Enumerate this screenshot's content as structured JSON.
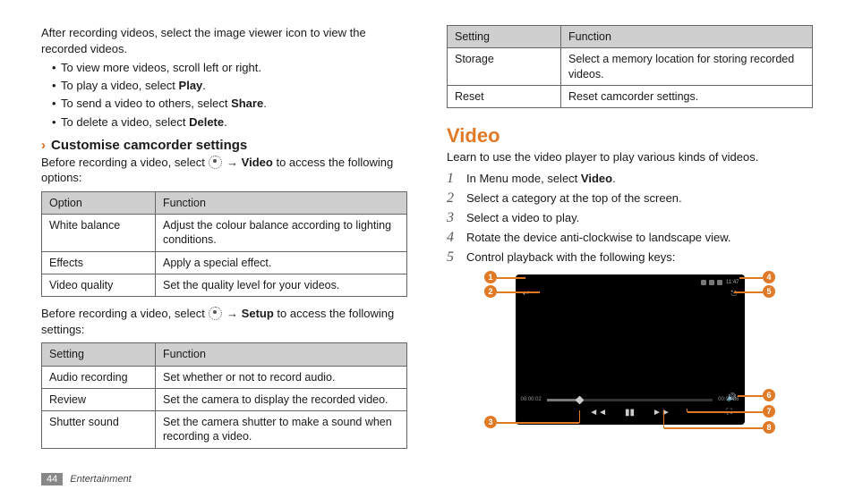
{
  "left": {
    "intro": "After recording videos, select the image viewer icon to view the recorded videos.",
    "bullets": {
      "b1a": "To view more videos, scroll left or right.",
      "b2a": "To play a video, select ",
      "b2b": "Play",
      "b2c": ".",
      "b3a": "To send a video to others, select ",
      "b3b": "Share",
      "b3c": ".",
      "b4a": "To delete a video, select ",
      "b4b": "Delete",
      "b4c": "."
    },
    "subhead": "Customise camcorder settings",
    "options_intro_a": "Before recording a video, select ",
    "options_intro_b": " → ",
    "options_intro_c": "Video",
    "options_intro_d": " to access the following options:",
    "options_table": {
      "h1": "Option",
      "h2": "Function",
      "r1c1": "White balance",
      "r1c2": "Adjust the colour balance according to lighting conditions.",
      "r2c1": "Effects",
      "r2c2": "Apply a special effect.",
      "r3c1": "Video quality",
      "r3c2": "Set the quality level for your videos."
    },
    "settings_intro_a": "Before recording a video, select ",
    "settings_intro_b": " → ",
    "settings_intro_c": "Setup",
    "settings_intro_d": " to access the following settings:",
    "settings_table": {
      "h1": "Setting",
      "h2": "Function",
      "r1c1": "Audio recording",
      "r1c2": "Set whether or not to record audio.",
      "r2c1": "Review",
      "r2c2": "Set the camera to display the recorded video.",
      "r3c1": "Shutter sound",
      "r3c2": "Set the camera shutter to make a sound when recording a video."
    }
  },
  "right": {
    "top_table": {
      "h1": "Setting",
      "h2": "Function",
      "r1c1": "Storage",
      "r1c2": "Select a memory location for storing recorded videos.",
      "r2c1": "Reset",
      "r2c2": "Reset camcorder settings."
    },
    "section": "Video",
    "section_intro": "Learn to use the video player to play various kinds of videos.",
    "steps": {
      "s1a": "In Menu mode, select ",
      "s1b": "Video",
      "s1c": ".",
      "s2": "Select a category at the top of the screen.",
      "s3": "Select a video to play.",
      "s4": "Rotate the device anti-clockwise to landscape view.",
      "s5": "Control playback with the following keys:"
    },
    "player": {
      "clock": "11:47",
      "time_start": "00:00:02",
      "time_end": "00:00:36"
    },
    "callouts": {
      "c1": "1",
      "c2": "2",
      "c3": "3",
      "c4": "4",
      "c5": "5",
      "c6": "6",
      "c7": "7",
      "c8": "8"
    }
  },
  "footer": {
    "page": "44",
    "section": "Entertainment"
  }
}
